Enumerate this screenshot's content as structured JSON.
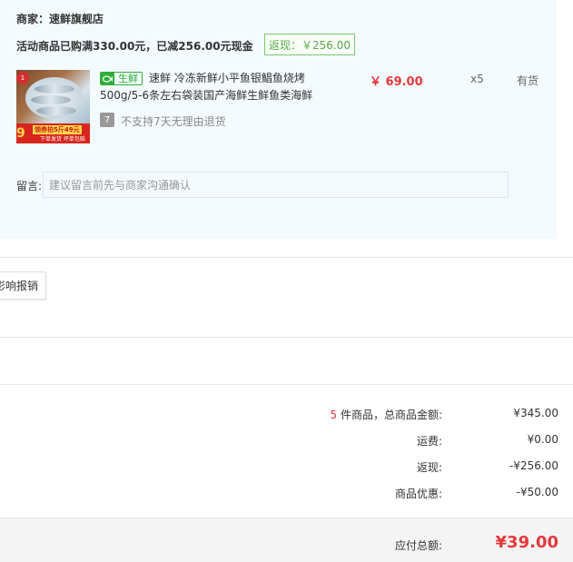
{
  "merchant": {
    "label": "商家：速鲜旗舰店"
  },
  "promo": {
    "text": "活动商品已购满330.00元，已减256.00元现金",
    "rebate_badge": "返现：￥256.00"
  },
  "product": {
    "fresh_badge_icon": "fish-icon",
    "fresh_badge": "生鲜",
    "title": "速鲜 冷冻新鲜小平鱼银鲳鱼烧烤500g/5-6条左右袋装国产海鲜生鲜鱼类海鲜",
    "price": "￥ 69.00",
    "quantity": "x5",
    "stock": "有货",
    "return_policy_icon": "seven-day-icon",
    "return_policy_icon_glyph": "7",
    "return_policy": "不支持7天无理由退货",
    "thumb_tag": "1",
    "thumb_banner_price": "9",
    "thumb_banner_text": "领券拍5斤49元",
    "thumb_banner_sub": "下单发货  坏单包赔"
  },
  "note": {
    "label": "留言:",
    "placeholder": "建议留言前先与商家沟通确认"
  },
  "invoice": {
    "button": "影响报销"
  },
  "summary": {
    "count": "5",
    "goods_label": " 件商品，总商品金额:",
    "goods_value": "¥345.00",
    "shipping_label": "运费:",
    "shipping_value": "¥0.00",
    "rebate_label": "返现:",
    "rebate_value": "-¥256.00",
    "discount_label": "商品优惠:",
    "discount_value": "-¥50.00"
  },
  "total": {
    "label": "应付总额:",
    "value": "¥39.00"
  },
  "colors": {
    "accent_red": "#e4393c",
    "fresh_green": "#2fae3a",
    "rebate_green": "#5aa84e",
    "panel_bg": "#f3fbfe"
  }
}
